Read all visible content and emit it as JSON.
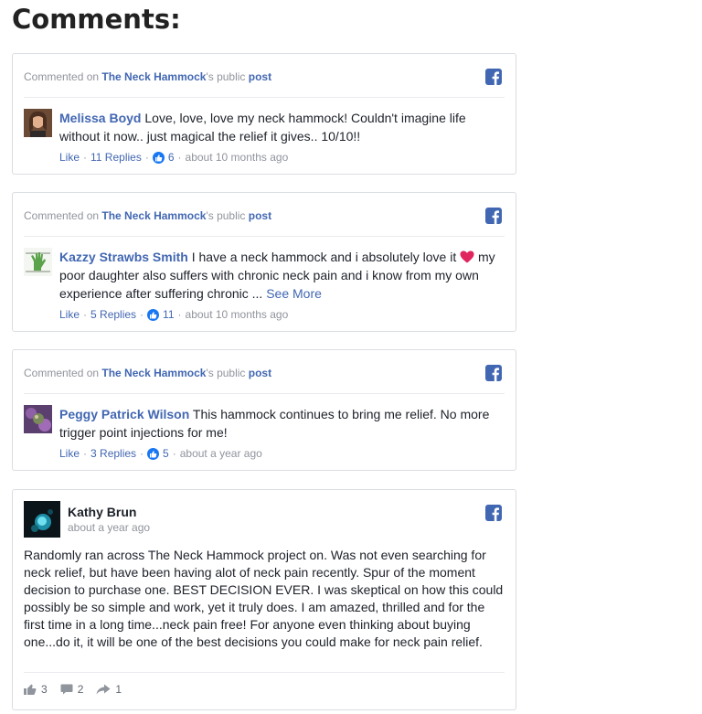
{
  "page_title": "Comments:",
  "colors": {
    "facebook_blue": "#4267b2",
    "muted_text": "#90949c",
    "heart_red": "#e0245e",
    "like_badge": "#1877f2"
  },
  "comments": [
    {
      "header": {
        "prefix": "Commented on",
        "page_name": "The Neck Hammock",
        "middle": "'s public",
        "post_link": "post"
      },
      "icon": "facebook-icon",
      "author": "Melissa Boyd",
      "text": "Love, love, love my neck hammock! Couldn't imagine life without it now.. just magical the relief it gives.. 10/10!!",
      "like_label": "Like",
      "replies_label": "11 Replies",
      "like_count": "6",
      "time": "about 10 months ago"
    },
    {
      "header": {
        "prefix": "Commented on",
        "page_name": "The Neck Hammock",
        "middle": "'s public",
        "post_link": "post"
      },
      "icon": "facebook-icon",
      "author": "Kazzy Strawbs Smith",
      "text_before_emoji": "I have a neck hammock and i absolutely love it",
      "emoji": "heart-emoji",
      "text_after_emoji": "my poor daughter also suffers with chronic neck pain and i know from my own experience after suffering chronic ...",
      "see_more": "See More",
      "like_label": "Like",
      "replies_label": "5 Replies",
      "like_count": "11",
      "time": "about 10 months ago"
    },
    {
      "header": {
        "prefix": "Commented on",
        "page_name": "The Neck Hammock",
        "middle": "'s public",
        "post_link": "post"
      },
      "icon": "facebook-icon",
      "author": "Peggy Patrick Wilson",
      "text": "This hammock continues to bring me relief. No more trigger point injections for me!",
      "like_label": "Like",
      "replies_label": "3 Replies",
      "like_count": "5",
      "time": "about a year ago"
    }
  ],
  "post": {
    "icon": "facebook-icon",
    "author": "Kathy Brun",
    "time": "about a year ago",
    "body": "Randomly ran across The Neck Hammock project on. Was not even searching for neck relief, but have been having alot of neck pain recently. Spur of the moment decision to purchase one. BEST DECISION EVER. I was skeptical on how this could possibly be so simple and work, yet it truly does. I am amazed, thrilled and for the first time in a long time...neck pain free! For anyone even thinking about buying one...do it, it will be one of the best decisions you could make for neck pain relief.",
    "likes": "3",
    "comments": "2",
    "shares": "1"
  }
}
